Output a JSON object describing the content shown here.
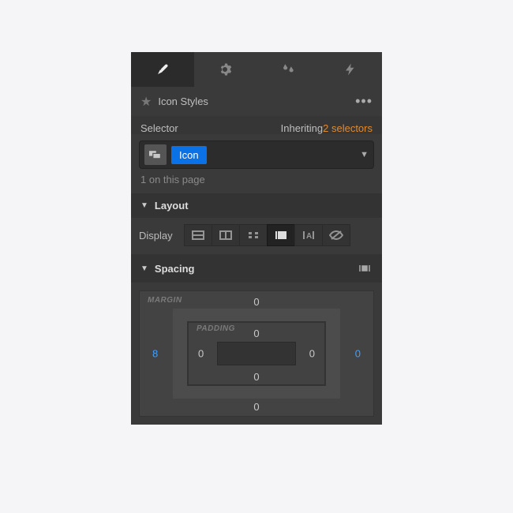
{
  "panel": {
    "title": "Icon Styles",
    "selector": {
      "label": "Selector",
      "inheriting_prefix": "Inheriting ",
      "inheriting_count": "2 selectors",
      "token": "Icon",
      "page_count": "1 on this page"
    },
    "sections": {
      "layout": "Layout",
      "spacing": "Spacing",
      "display_label": "Display"
    },
    "spacing": {
      "margin_label": "MARGIN",
      "padding_label": "PADDING",
      "margin": {
        "top": "0",
        "right": "0",
        "bottom": "0",
        "left": "8"
      },
      "padding": {
        "top": "0",
        "right": "0",
        "bottom": "0",
        "left": "0"
      }
    }
  }
}
